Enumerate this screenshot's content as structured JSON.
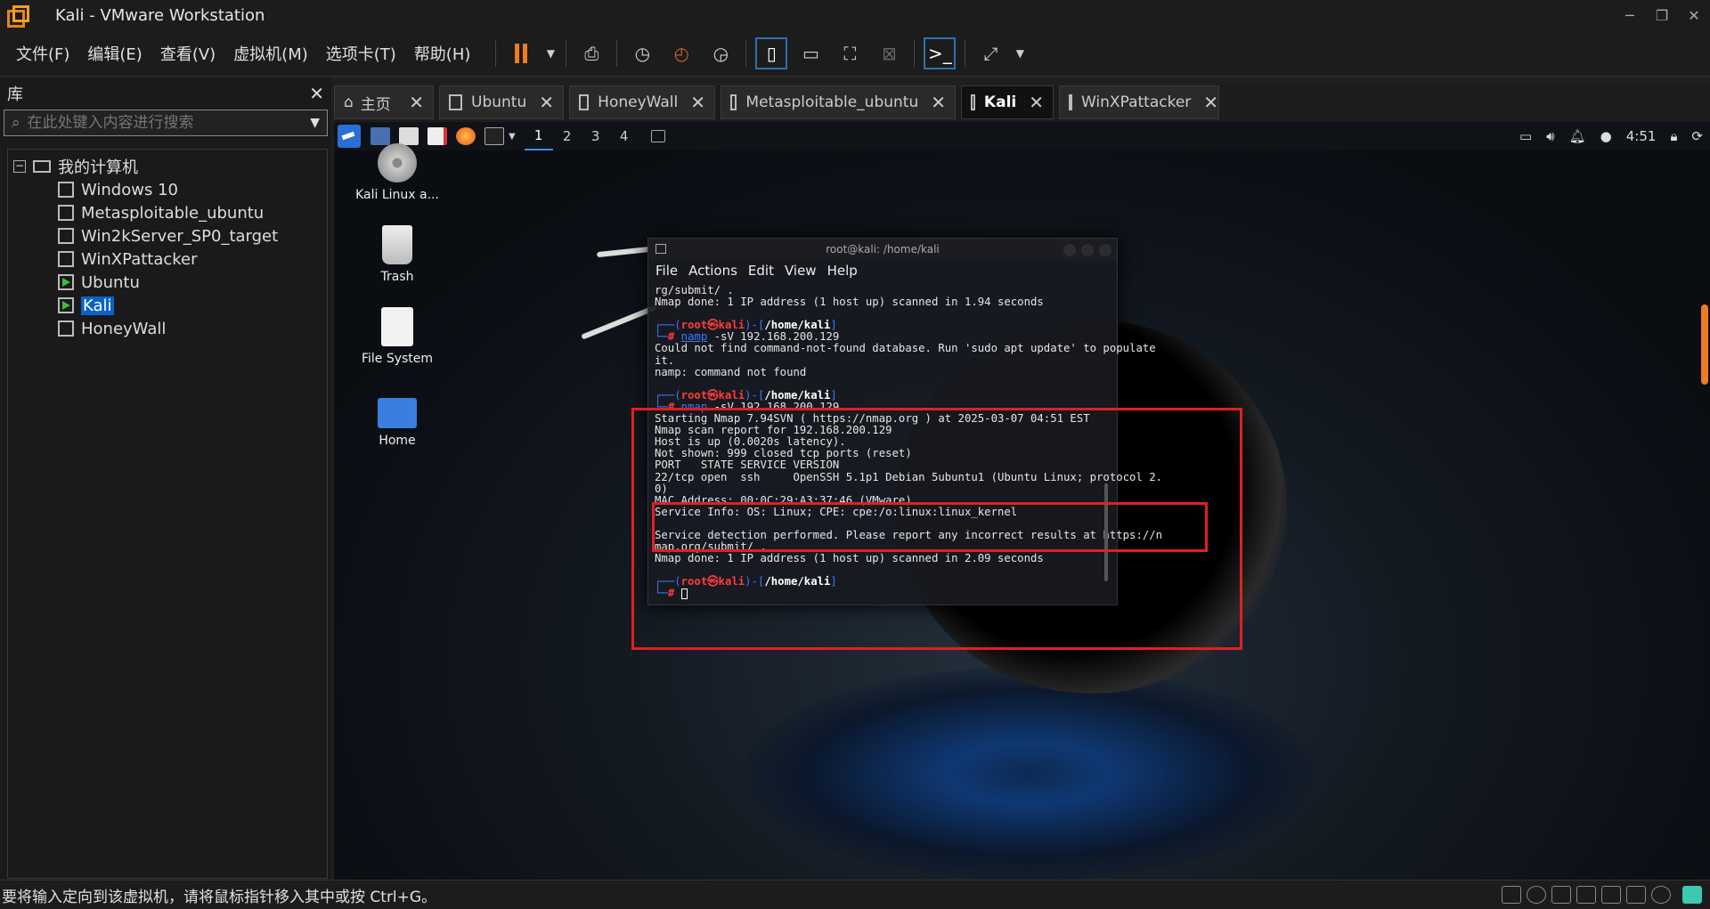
{
  "window": {
    "title": "Kali - VMware Workstation"
  },
  "menu": [
    "文件(F)",
    "编辑(E)",
    "查看(V)",
    "虚拟机(M)",
    "选项卡(T)",
    "帮助(H)"
  ],
  "library": {
    "title": "库",
    "search_placeholder": "在此处键入内容进行搜索",
    "root": "我的计算机",
    "items": [
      "Windows 10",
      "Metasploitable_ubuntu",
      "Win2kServer_SP0_target",
      "WinXPattacker",
      "Ubuntu",
      "Kali",
      "HoneyWall"
    ]
  },
  "tabs": [
    "主页",
    "Ubuntu",
    "HoneyWall",
    "Metasploitable_ubuntu",
    "Kali",
    "WinXPattacker"
  ],
  "guest": {
    "workspaces": [
      "1",
      "2",
      "3",
      "4"
    ],
    "clock": "4:51",
    "desktop_icons": [
      "Kali Linux a...",
      "Trash",
      "File System",
      "Home"
    ]
  },
  "terminal": {
    "title": "root@kali: /home/kali",
    "menu": [
      "File",
      "Actions",
      "Edit",
      "View",
      "Help"
    ],
    "lines": {
      "l1": "rg/submit/ .",
      "l2": "Nmap done: 1 IP address (1 host up) scanned in 1.94 seconds",
      "p1_root": "root㉿kali",
      "p1_path": "/home/kali",
      "c1_cmd": "namp",
      "c1_args": " -sV 192.168.200.129",
      "e1": "Could not find command-not-found database. Run 'sudo apt update' to populate",
      "e2": "it.",
      "e3": "namp: command not found",
      "c2_cmd": "nmap",
      "c2_args": " -sV 192.168.200.129",
      "o1": "Starting Nmap 7.94SVN ( https://nmap.org ) at 2025-03-07 04:51 EST",
      "o2": "Nmap scan report for 192.168.200.129",
      "o3": "Host is up (0.0020s latency).",
      "o4": "Not shown: 999 closed tcp ports (reset)",
      "o5": "PORT   STATE SERVICE VERSION",
      "o6": "22/tcp open  ssh     OpenSSH 5.1p1 Debian 5ubuntu1 (Ubuntu Linux; protocol 2.",
      "o7": "0)",
      "o8": "MAC Address: 00:0C:29:A3:37:46 (VMware)",
      "o9": "Service Info: OS: Linux; CPE: cpe:/o:linux:linux_kernel",
      "o10": "Service detection performed. Please report any incorrect results at https://n",
      "o11": "map.org/submit/ .",
      "o12": "Nmap done: 1 IP address (1 host up) scanned in 2.09 seconds"
    }
  },
  "status": {
    "text": "要将输入定向到该虚拟机，请将鼠标指针移入其中或按 Ctrl+G。"
  }
}
